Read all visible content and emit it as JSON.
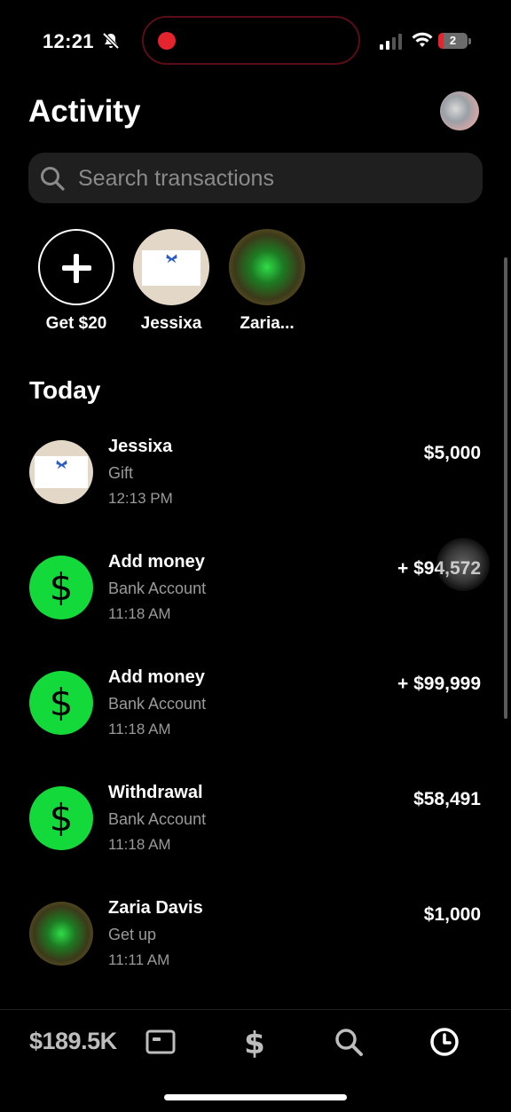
{
  "status_bar": {
    "time": "12:21",
    "battery_level": "2"
  },
  "header": {
    "title": "Activity"
  },
  "search": {
    "placeholder": "Search transactions"
  },
  "quick_contacts": [
    {
      "label": "Get $20"
    },
    {
      "label": "Jessixa"
    },
    {
      "label": "Zaria..."
    }
  ],
  "sections": {
    "today": "Today"
  },
  "transactions": [
    {
      "name": "Jessixa",
      "note": "Gift",
      "time": "12:13 PM",
      "amount": "$5,000"
    },
    {
      "name": "Add money",
      "note": "Bank Account",
      "time": "11:18 AM",
      "amount": "+ $94,572"
    },
    {
      "name": "Add money",
      "note": "Bank Account",
      "time": "11:18 AM",
      "amount": "+ $99,999"
    },
    {
      "name": "Withdrawal",
      "note": "Bank Account",
      "time": "11:18 AM",
      "amount": "$58,491"
    },
    {
      "name": "Zaria Davis",
      "note": "Get up",
      "time": "11:11 AM",
      "amount": "$1,000"
    }
  ],
  "nav": {
    "balance": "$189.5K",
    "icons": [
      "card-icon",
      "dollar-icon",
      "search-icon",
      "clock-icon"
    ]
  },
  "colors": {
    "accent_green": "#13d93b",
    "background": "#000000",
    "recording_red": "#e5242e"
  }
}
